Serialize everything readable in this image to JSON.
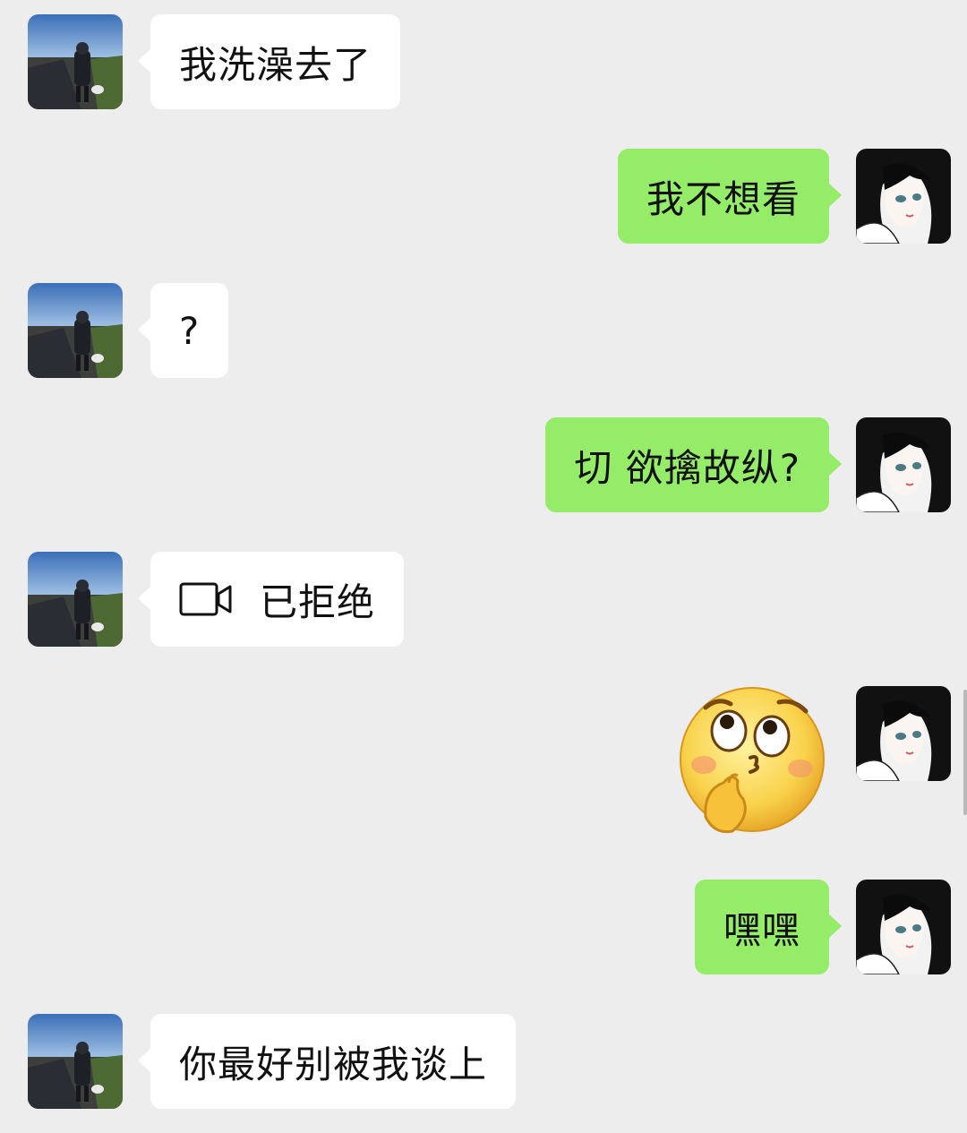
{
  "messages": [
    {
      "side": "left",
      "type": "text",
      "text": "我洗澡去了"
    },
    {
      "side": "right",
      "type": "text",
      "text": "我不想看"
    },
    {
      "side": "left",
      "type": "text",
      "text": "?"
    },
    {
      "side": "right",
      "type": "text",
      "text": "切 欲擒故纵?"
    },
    {
      "side": "left",
      "type": "call",
      "text": "已拒绝",
      "icon": "video-call-icon"
    },
    {
      "side": "right",
      "type": "sticker",
      "icon": "thinking-face-sticker"
    },
    {
      "side": "right",
      "type": "text",
      "text": "嘿嘿"
    },
    {
      "side": "left",
      "type": "text",
      "text": "你最好别被我谈上"
    }
  ],
  "avatars": {
    "left": "avatar-person-walking-dog",
    "right": "avatar-anime-girl"
  },
  "colors": {
    "background": "#ededed",
    "incoming_bubble": "#ffffff",
    "outgoing_bubble": "#95ec69"
  }
}
